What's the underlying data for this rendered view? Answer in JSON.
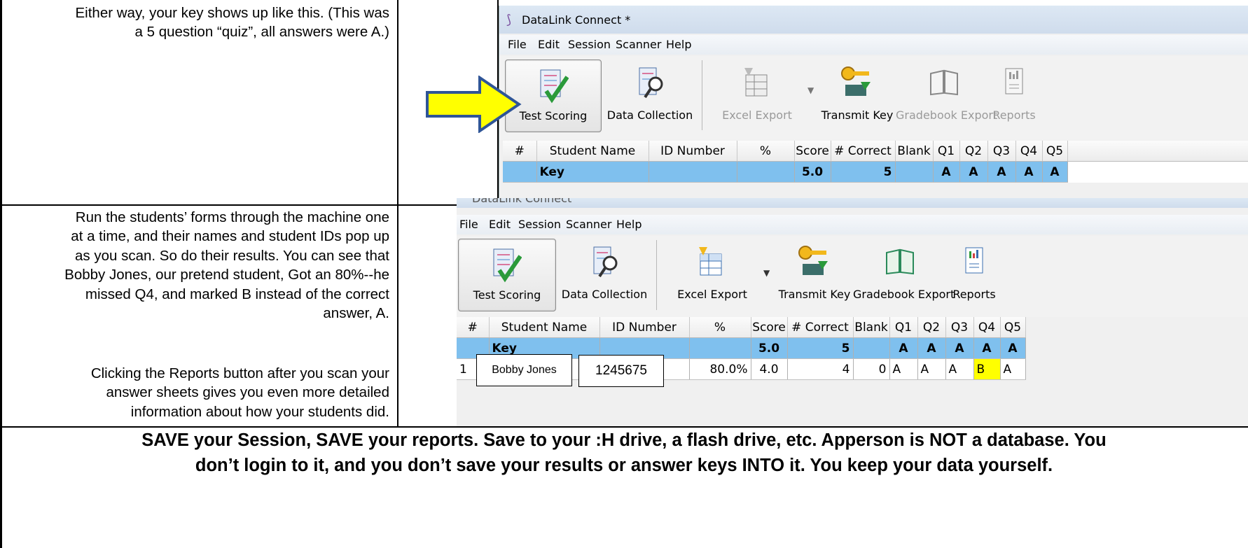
{
  "rows": [
    {
      "description": [
        "Either way, your key shows up like this.  (This was",
        "a 5 question “quiz”, all answers were A.)"
      ]
    },
    {
      "description": [
        "Run the students’ forms through the machine one",
        "at a time, and their names and student IDs pop up",
        "as you scan.  So do their results.  You can see that",
        "Bobby Jones, our pretend student, Got an 80%--he",
        "missed Q4, and marked B instead of the correct",
        "answer, A."
      ],
      "description2": [
        "Clicking the Reports button after you scan your",
        "answer sheets gives you even more detailed",
        "information about how your students did."
      ]
    }
  ],
  "footer": [
    "SAVE your Session, SAVE your reports.  Save to your :H drive, a flash drive, etc.  Apperson is NOT a database.  You",
    "don’t login to it, and you don’t save your results or answer keys INTO it.  You keep your data  yourself."
  ],
  "app": {
    "title": "DataLink Connect *",
    "title_partial": "DataLink Connect",
    "menu": [
      "File",
      "Edit",
      "Session",
      "Scanner",
      "Help"
    ],
    "toolbar": [
      "Test Scoring",
      "Data Collection",
      "Excel Export",
      "Transmit Key",
      "Gradebook Export",
      "Reports"
    ],
    "columns": [
      "#",
      "Student Name",
      "ID Number",
      "%",
      "Score",
      "# Correct",
      "Blank",
      "Q1",
      "Q2",
      "Q3",
      "Q4",
      "Q5"
    ],
    "key_row": {
      "name": "Key",
      "score": "5.0",
      "correct": "5",
      "answers": [
        "A",
        "A",
        "A",
        "A",
        "A"
      ]
    },
    "student_row": {
      "num": "1",
      "name": "Bobby Jones",
      "id": "1245675",
      "pct": "80.0%",
      "score": "4.0",
      "correct": "4",
      "blank": "0",
      "answers": [
        "A",
        "A",
        "A",
        "B",
        "A"
      ]
    }
  },
  "colors": {
    "arrow_fill": "#ffff00",
    "arrow_stroke": "#2f5597",
    "key_row": "#7fc0ee",
    "wrong_answer": "#ffff00"
  }
}
